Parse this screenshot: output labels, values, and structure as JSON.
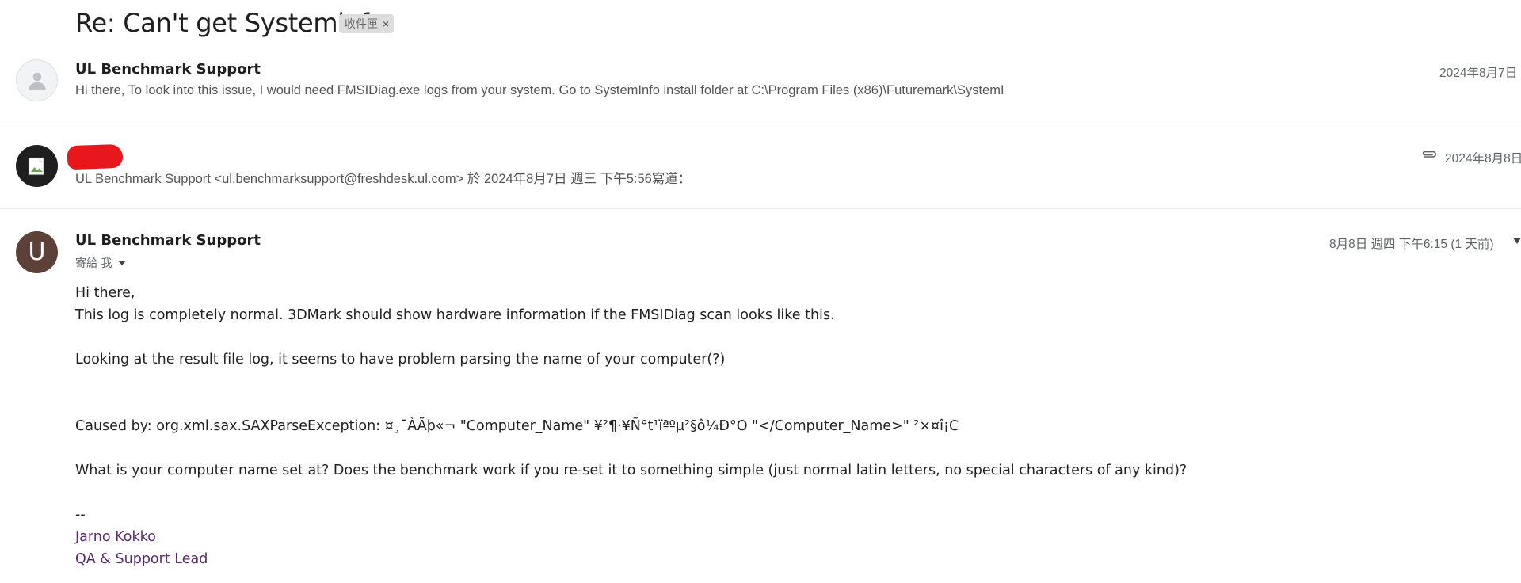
{
  "thread": {
    "subject": "Re: Can't get Systeminfo",
    "label": "收件匣",
    "label_remove": "×"
  },
  "messages": [
    {
      "sender": "UL Benchmark Support",
      "snippet": "Hi there, To look into this issue, I would need FMSIDiag.exe logs from your system. Go to SystemInfo install folder at C:\\Program Files (x86)\\Futuremark\\SystemI",
      "date": "2024年8月7日"
    },
    {
      "sender": "",
      "snippet": "UL Benchmark Support <ul.benchmarksupport@freshdesk.ul.com> 於 2024年8月7日 週三 下午5:56寫道：",
      "date": "2024年8月8日"
    },
    {
      "sender": "UL Benchmark Support",
      "avatar_letter": "U",
      "to": "寄給 我",
      "date": "8月8日 週四 下午6:15 (1 天前)",
      "body": [
        "Hi there,",
        "This log is completely normal. 3DMark should show hardware information if the FMSIDiag scan looks like this.",
        "Looking at the result file log, it seems to have problem parsing the name of your computer(?)",
        "Caused by: org.xml.sax.SAXParseException: ¤¸¯ÀÃþ«¬ \"Computer_Name\" ¥²¶·¥Ñ°t¹ïªºµ²§ô¼Ð°O \"</Computer_Name>\" ²×¤î¡C",
        "What is your computer name set at? Does the benchmark work if you re-set it to something simple (just normal latin letters, no special characters of any kind)?",
        "--"
      ],
      "signature": {
        "name": "Jarno Kokko",
        "title": "QA & Support Lead"
      }
    }
  ],
  "icons": {
    "attachment": "paperclip-icon",
    "dropdown": "chevron-down-icon",
    "avatar_default": "person-icon",
    "broken_image": "broken-image-icon"
  }
}
